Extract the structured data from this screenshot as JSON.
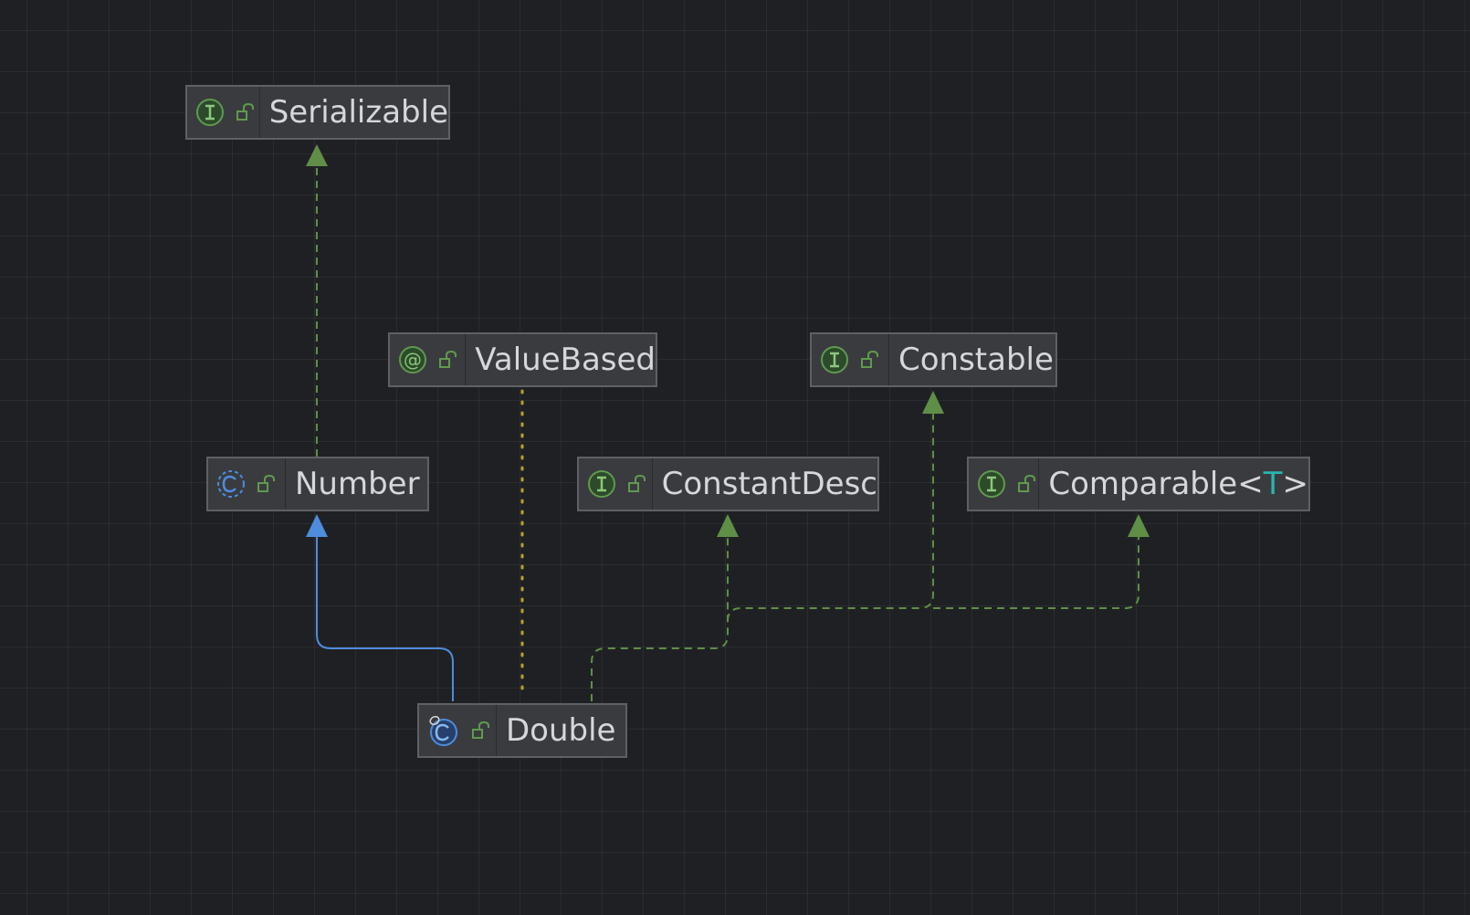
{
  "diagram": {
    "colors": {
      "background": "#1f2024",
      "node_fill": "#3a3b3f",
      "node_border": "#5e6064",
      "interface_arrow": "#5f8f47",
      "class_arrow": "#4e8cdc",
      "annotation_link": "#b8a22a",
      "type_param": "#28b5ac"
    },
    "nodes": {
      "serializable": {
        "name": "Serializable",
        "kind": "interface",
        "icons": [
          "interface-icon",
          "public-lock-icon"
        ]
      },
      "valuebased": {
        "name": "ValueBased",
        "kind": "annotation",
        "icons": [
          "annotation-icon",
          "public-lock-icon"
        ]
      },
      "constable": {
        "name": "Constable",
        "kind": "interface",
        "icons": [
          "interface-icon",
          "public-lock-icon"
        ]
      },
      "number": {
        "name": "Number",
        "kind": "abstract-class",
        "icons": [
          "abstract-class-icon",
          "public-lock-icon"
        ]
      },
      "constantdesc": {
        "name": "ConstantDesc",
        "kind": "interface",
        "icons": [
          "interface-icon",
          "public-lock-icon"
        ]
      },
      "comparable": {
        "name": "Comparable<",
        "type_param": "T",
        "suffix": ">",
        "kind": "interface",
        "icons": [
          "interface-icon",
          "public-lock-icon"
        ]
      },
      "double": {
        "name": "Double",
        "kind": "final-class",
        "icons": [
          "final-class-icon",
          "public-lock-icon"
        ]
      }
    },
    "edges": [
      {
        "from": "number",
        "to": "serializable",
        "type": "implements"
      },
      {
        "from": "double",
        "to": "number",
        "type": "extends"
      },
      {
        "from": "double",
        "to": "valuebased",
        "type": "annotated-with"
      },
      {
        "from": "double",
        "to": "constantdesc",
        "type": "implements"
      },
      {
        "from": "double",
        "to": "constable",
        "type": "implements"
      },
      {
        "from": "double",
        "to": "comparable",
        "type": "implements"
      }
    ]
  }
}
